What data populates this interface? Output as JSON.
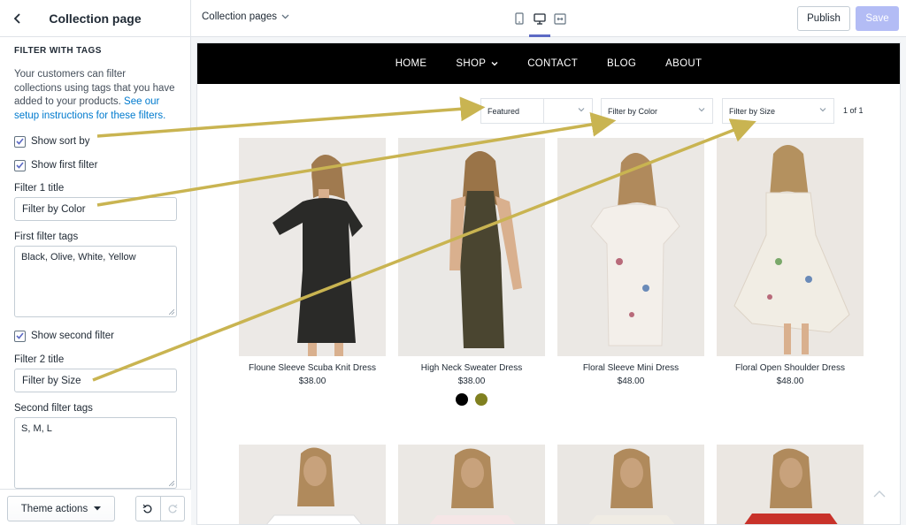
{
  "sidebar": {
    "title": "Collection page",
    "section_title": "FILTER WITH TAGS",
    "description": "Your customers can filter collections using tags that you have added to your products.",
    "description_link": "See our setup instructions for these filters.",
    "show_sort_by": {
      "label": "Show sort by",
      "checked": true
    },
    "show_first_filter": {
      "label": "Show first filter",
      "checked": true
    },
    "filter1_title_label": "Filter 1 title",
    "filter1_title_value": "Filter by Color",
    "first_filter_tags_label": "First filter tags",
    "first_filter_tags_value": "Black, Olive, White, Yellow",
    "show_second_filter": {
      "label": "Show second filter",
      "checked": true
    },
    "filter2_title_label": "Filter 2 title",
    "filter2_title_value": "Filter by Size",
    "second_filter_tags_label": "Second filter tags",
    "second_filter_tags_value": "S, M, L",
    "theme_actions": "Theme actions"
  },
  "topbar": {
    "page_select": "Collection pages",
    "publish": "Publish",
    "save": "Save"
  },
  "store": {
    "nav": [
      "HOME",
      "SHOP",
      "CONTACT",
      "BLOG",
      "ABOUT"
    ],
    "sort_select": "Featured",
    "filter1_select": "Filter by Color",
    "filter2_select": "Filter by Size",
    "pager": "1 of 1",
    "products": [
      {
        "name": "Floune Sleeve Scuba Knit Dress",
        "price": "$38.00",
        "dress_color": "#2a2a28"
      },
      {
        "name": "High Neck Sweater Dress",
        "price": "$38.00",
        "dress_color": "#4a4530"
      },
      {
        "name": "Floral Sleeve Mini Dress",
        "price": "$48.00",
        "dress_color": "#f3efea"
      },
      {
        "name": "Floral Open Shoulder Dress",
        "price": "$48.00",
        "dress_color": "#f1ede4"
      }
    ],
    "swatches": [
      "#000000",
      "#808020"
    ]
  },
  "colors": {
    "accent": "#5c6ac4",
    "link": "#007ace",
    "arrow": "#c9b451"
  }
}
